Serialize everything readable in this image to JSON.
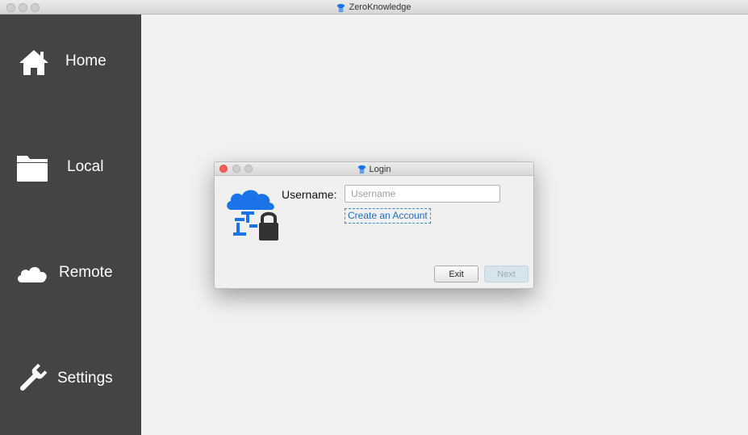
{
  "window": {
    "title": "ZeroKnowledge",
    "app_icon": "zeroknowledge-app-icon"
  },
  "sidebar": {
    "items": [
      {
        "label": "Home",
        "icon": "home-icon"
      },
      {
        "label": "Local",
        "icon": "folder-icon"
      },
      {
        "label": "Remote",
        "icon": "cloud-icon"
      },
      {
        "label": "Settings",
        "icon": "wrench-icon"
      }
    ]
  },
  "dialog": {
    "title": "Login",
    "logo": "cloud-lock-logo",
    "username_label": "Username:",
    "username_placeholder": "Username",
    "username_value": "",
    "create_account_label": "Create an Account",
    "exit_label": "Exit",
    "next_label": "Next",
    "next_enabled": false
  },
  "colors": {
    "sidebar_bg": "#444444",
    "content_bg": "#f2f2f2",
    "link": "#1a6fbf",
    "brand_blue": "#1a73e8",
    "close_red": "#fc605b"
  }
}
